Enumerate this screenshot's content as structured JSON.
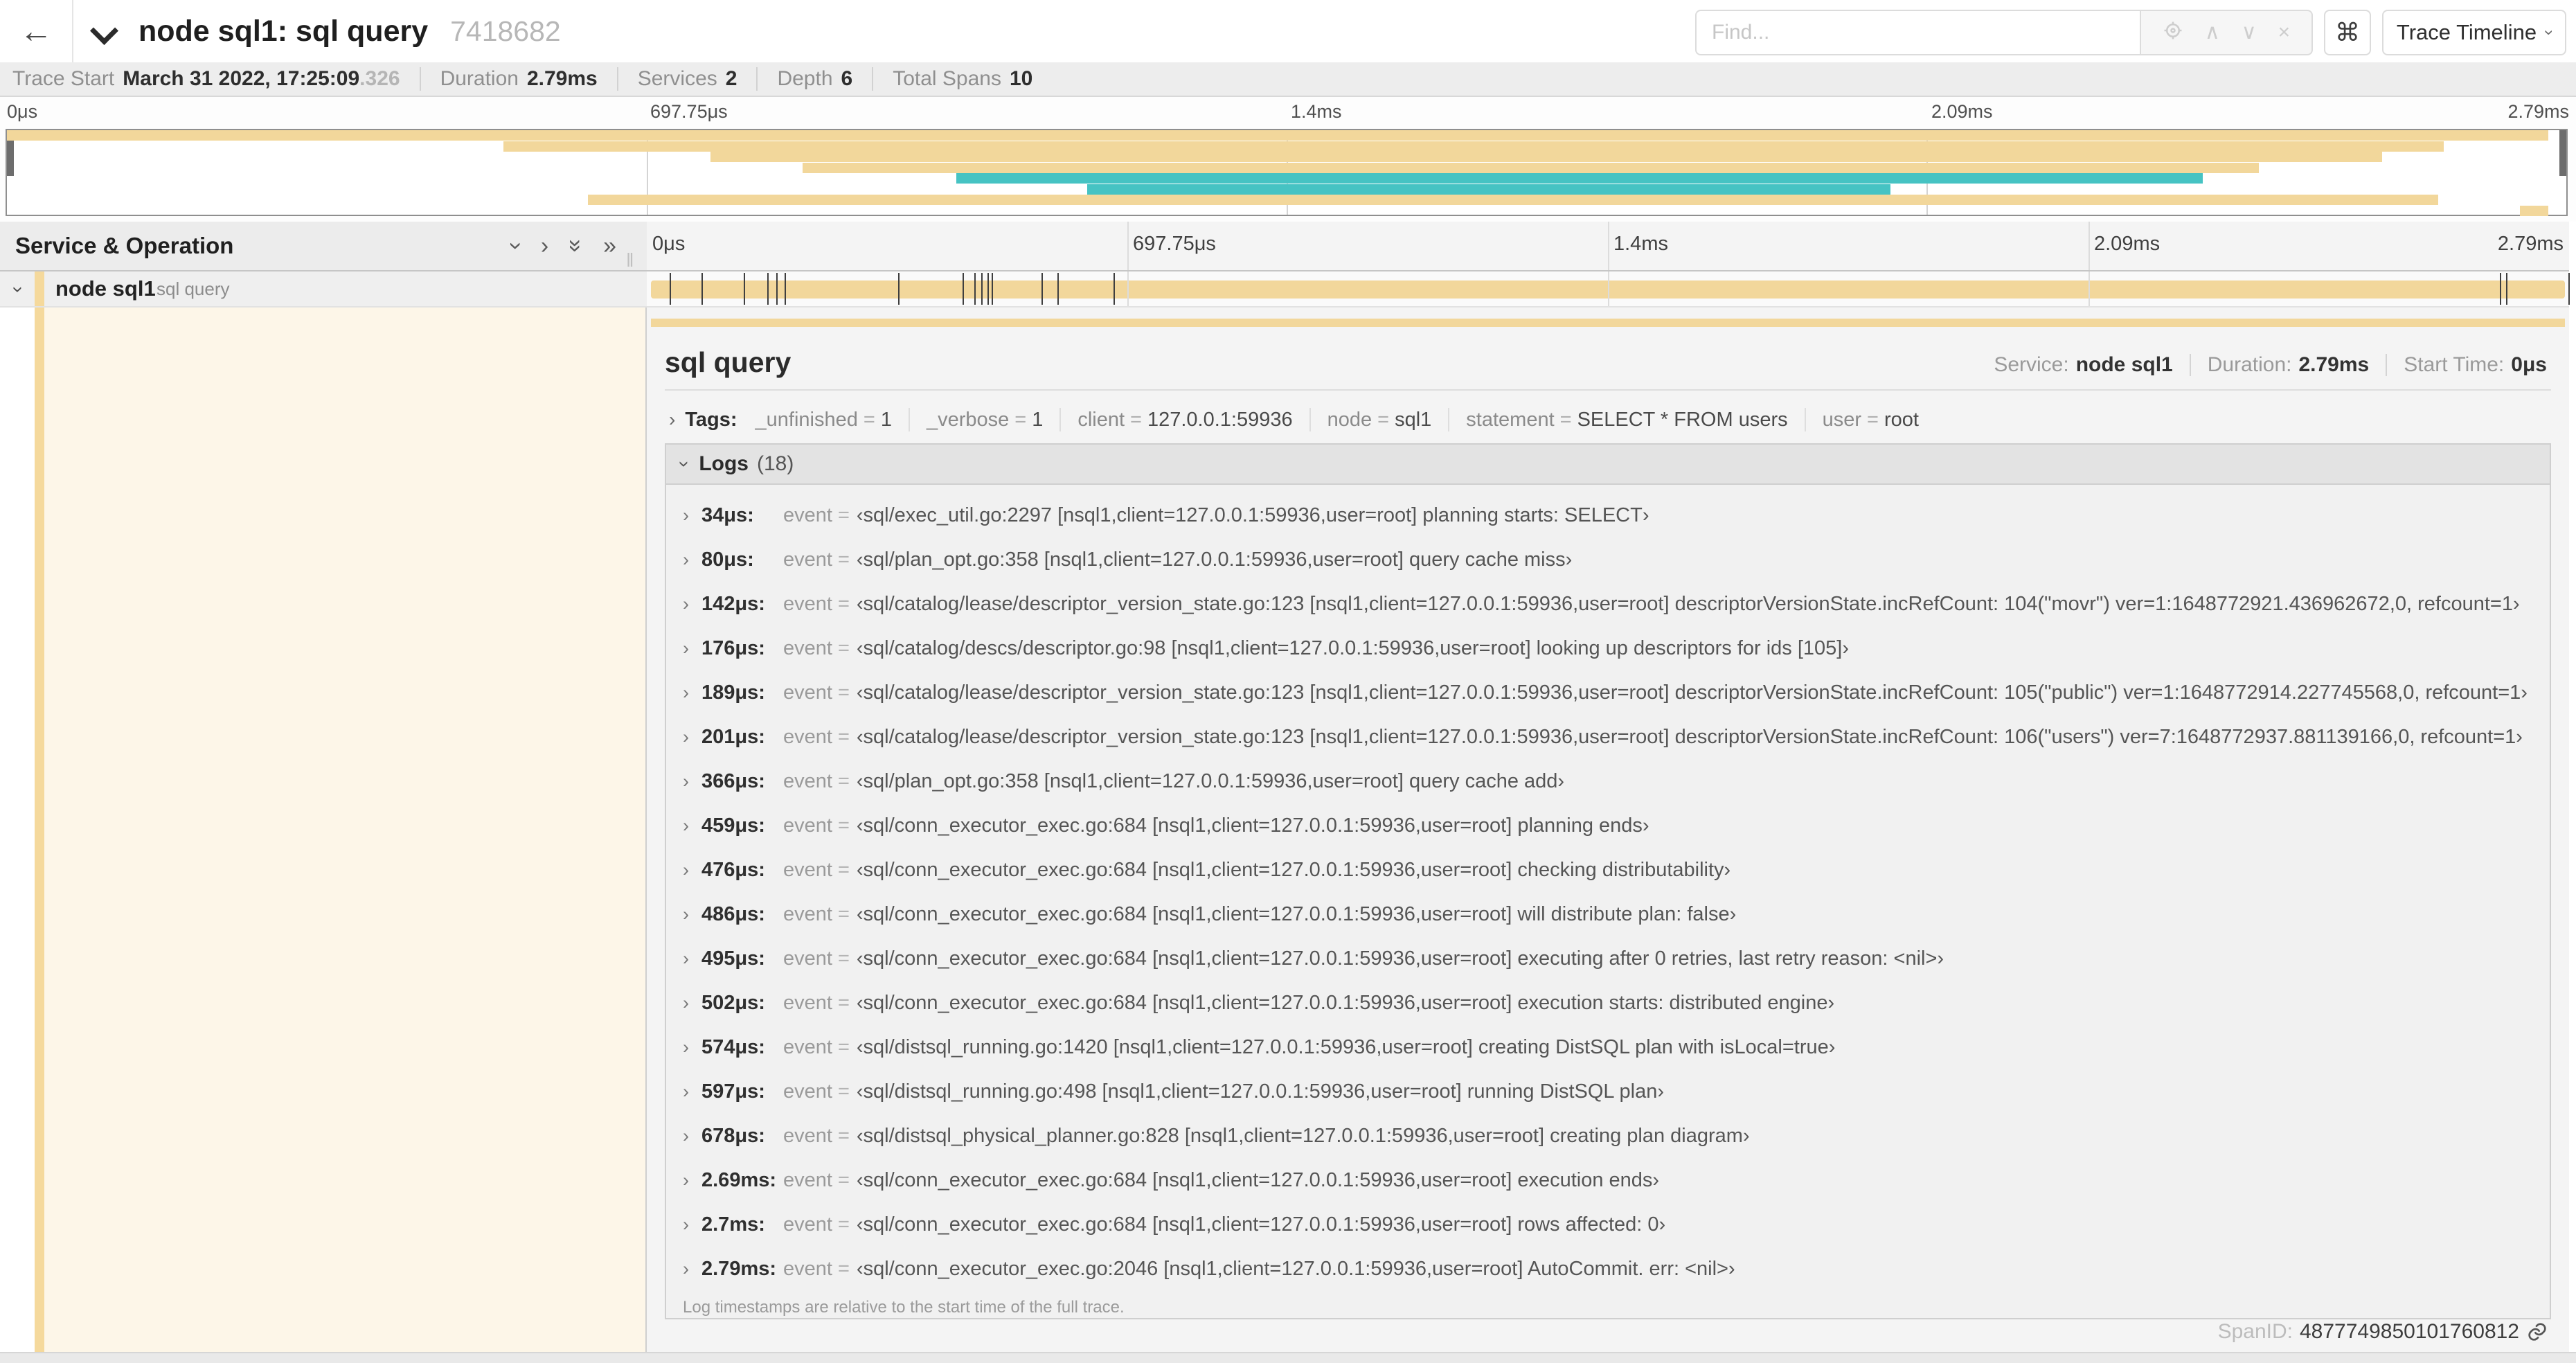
{
  "header": {
    "back_icon": "left-arrow",
    "title": "node sql1: sql query",
    "trace_id": "7418682",
    "find_placeholder": "Find...",
    "find_tools": [
      "crosshair-icon",
      "up-chevron-icon",
      "down-chevron-icon",
      "close-icon"
    ],
    "shortcut_icon": "⌘",
    "view_dropdown": "Trace Timeline"
  },
  "meta": {
    "trace_start_label": "Trace Start",
    "trace_start_value": "March 31 2022, 17:25:09",
    "trace_start_ms": ".326",
    "duration_label": "Duration",
    "duration_value": "2.79ms",
    "services_label": "Services",
    "services_value": "2",
    "depth_label": "Depth",
    "depth_value": "6",
    "spans_label": "Total Spans",
    "spans_value": "10"
  },
  "timeline": {
    "tick_labels": [
      "0μs",
      "697.75μs",
      "1.4ms",
      "2.09ms",
      "2.79ms"
    ],
    "tick_fractions": [
      0,
      0.25,
      0.5,
      0.75,
      1
    ],
    "grid_fractions": [
      0.25,
      0.5,
      0.75
    ],
    "duration_us": 2790,
    "log_marks_us": [
      34,
      80,
      142,
      176,
      189,
      201,
      366,
      459,
      476,
      486,
      495,
      502,
      574,
      597,
      678,
      2690,
      2700,
      2790
    ],
    "minimap_bars": [
      {
        "row": 0,
        "start": 0.0,
        "end": 99.3,
        "color": "tan"
      },
      {
        "row": 1,
        "start": 19.4,
        "end": 95.2,
        "color": "tan"
      },
      {
        "row": 2,
        "start": 27.5,
        "end": 92.8,
        "color": "tan"
      },
      {
        "row": 3,
        "start": 31.1,
        "end": 88.0,
        "color": "tan"
      },
      {
        "row": 4,
        "start": 37.1,
        "end": 85.8,
        "color": "teal"
      },
      {
        "row": 5,
        "start": 42.2,
        "end": 73.6,
        "color": "teal"
      },
      {
        "row": 6,
        "start": 22.7,
        "end": 95.0,
        "color": "tan"
      },
      {
        "row": 7,
        "start": 98.2,
        "end": 99.3,
        "color": "tan"
      }
    ]
  },
  "left_panel": {
    "header": "Service & Operation",
    "row_service": "node sql1",
    "row_operation": "sql query"
  },
  "detail": {
    "title": "sql query",
    "service_label": "Service:",
    "service_value": "node sql1",
    "duration_label": "Duration:",
    "duration_value": "2.79ms",
    "start_label": "Start Time:",
    "start_value": "0μs",
    "tags_label": "Tags:",
    "tags": [
      {
        "key": "_unfinished",
        "value": "1"
      },
      {
        "key": "_verbose",
        "value": "1"
      },
      {
        "key": "client",
        "value": "127.0.0.1:59936"
      },
      {
        "key": "node",
        "value": "sql1"
      },
      {
        "key": "statement",
        "value": "SELECT * FROM users"
      },
      {
        "key": "user",
        "value": "root"
      }
    ],
    "logs_label": "Logs",
    "logs_count": "(18)",
    "event_key": "event",
    "logs": [
      {
        "t": "34μs:",
        "v": "‹sql/exec_util.go:2297 [nsql1,client=127.0.0.1:59936,user=root] planning starts: SELECT›"
      },
      {
        "t": "80μs:",
        "v": "‹sql/plan_opt.go:358 [nsql1,client=127.0.0.1:59936,user=root] query cache miss›"
      },
      {
        "t": "142μs:",
        "v": "‹sql/catalog/lease/descriptor_version_state.go:123 [nsql1,client=127.0.0.1:59936,user=root] descriptorVersionState.incRefCount: 104(\"movr\") ver=1:1648772921.436962672,0, refcount=1›"
      },
      {
        "t": "176μs:",
        "v": "‹sql/catalog/descs/descriptor.go:98 [nsql1,client=127.0.0.1:59936,user=root] looking up descriptors for ids [105]›"
      },
      {
        "t": "189μs:",
        "v": "‹sql/catalog/lease/descriptor_version_state.go:123 [nsql1,client=127.0.0.1:59936,user=root] descriptorVersionState.incRefCount: 105(\"public\") ver=1:1648772914.227745568,0, refcount=1›"
      },
      {
        "t": "201μs:",
        "v": "‹sql/catalog/lease/descriptor_version_state.go:123 [nsql1,client=127.0.0.1:59936,user=root] descriptorVersionState.incRefCount: 106(\"users\") ver=7:1648772937.881139166,0, refcount=1›"
      },
      {
        "t": "366μs:",
        "v": "‹sql/plan_opt.go:358 [nsql1,client=127.0.0.1:59936,user=root] query cache add›"
      },
      {
        "t": "459μs:",
        "v": "‹sql/conn_executor_exec.go:684 [nsql1,client=127.0.0.1:59936,user=root] planning ends›"
      },
      {
        "t": "476μs:",
        "v": "‹sql/conn_executor_exec.go:684 [nsql1,client=127.0.0.1:59936,user=root] checking distributability›"
      },
      {
        "t": "486μs:",
        "v": "‹sql/conn_executor_exec.go:684 [nsql1,client=127.0.0.1:59936,user=root] will distribute plan: false›"
      },
      {
        "t": "495μs:",
        "v": "‹sql/conn_executor_exec.go:684 [nsql1,client=127.0.0.1:59936,user=root] executing after 0 retries, last retry reason: <nil>›"
      },
      {
        "t": "502μs:",
        "v": "‹sql/conn_executor_exec.go:684 [nsql1,client=127.0.0.1:59936,user=root] execution starts: distributed engine›"
      },
      {
        "t": "574μs:",
        "v": "‹sql/distsql_running.go:1420 [nsql1,client=127.0.0.1:59936,user=root] creating DistSQL plan with isLocal=true›"
      },
      {
        "t": "597μs:",
        "v": "‹sql/distsql_running.go:498 [nsql1,client=127.0.0.1:59936,user=root] running DistSQL plan›"
      },
      {
        "t": "678μs:",
        "v": "‹sql/distsql_physical_planner.go:828 [nsql1,client=127.0.0.1:59936,user=root] creating plan diagram›"
      },
      {
        "t": "2.69ms:",
        "v": "‹sql/conn_executor_exec.go:684 [nsql1,client=127.0.0.1:59936,user=root] execution ends›"
      },
      {
        "t": "2.7ms:",
        "v": "‹sql/conn_executor_exec.go:684 [nsql1,client=127.0.0.1:59936,user=root] rows affected: 0›"
      },
      {
        "t": "2.79ms:",
        "v": "‹sql/conn_executor_exec.go:2046 [nsql1,client=127.0.0.1:59936,user=root] AutoCommit. err: <nil>›"
      }
    ],
    "footer_note": "Log timestamps are relative to the start time of the full trace.",
    "spanid_label": "SpanID:",
    "spanid_value": "4877749850101760812"
  },
  "colors": {
    "span_tan": "#f2d79b",
    "span_teal": "#46c3c3",
    "stripe_tan": "#f5d99c",
    "selected_cream": "#fdf6e8"
  }
}
